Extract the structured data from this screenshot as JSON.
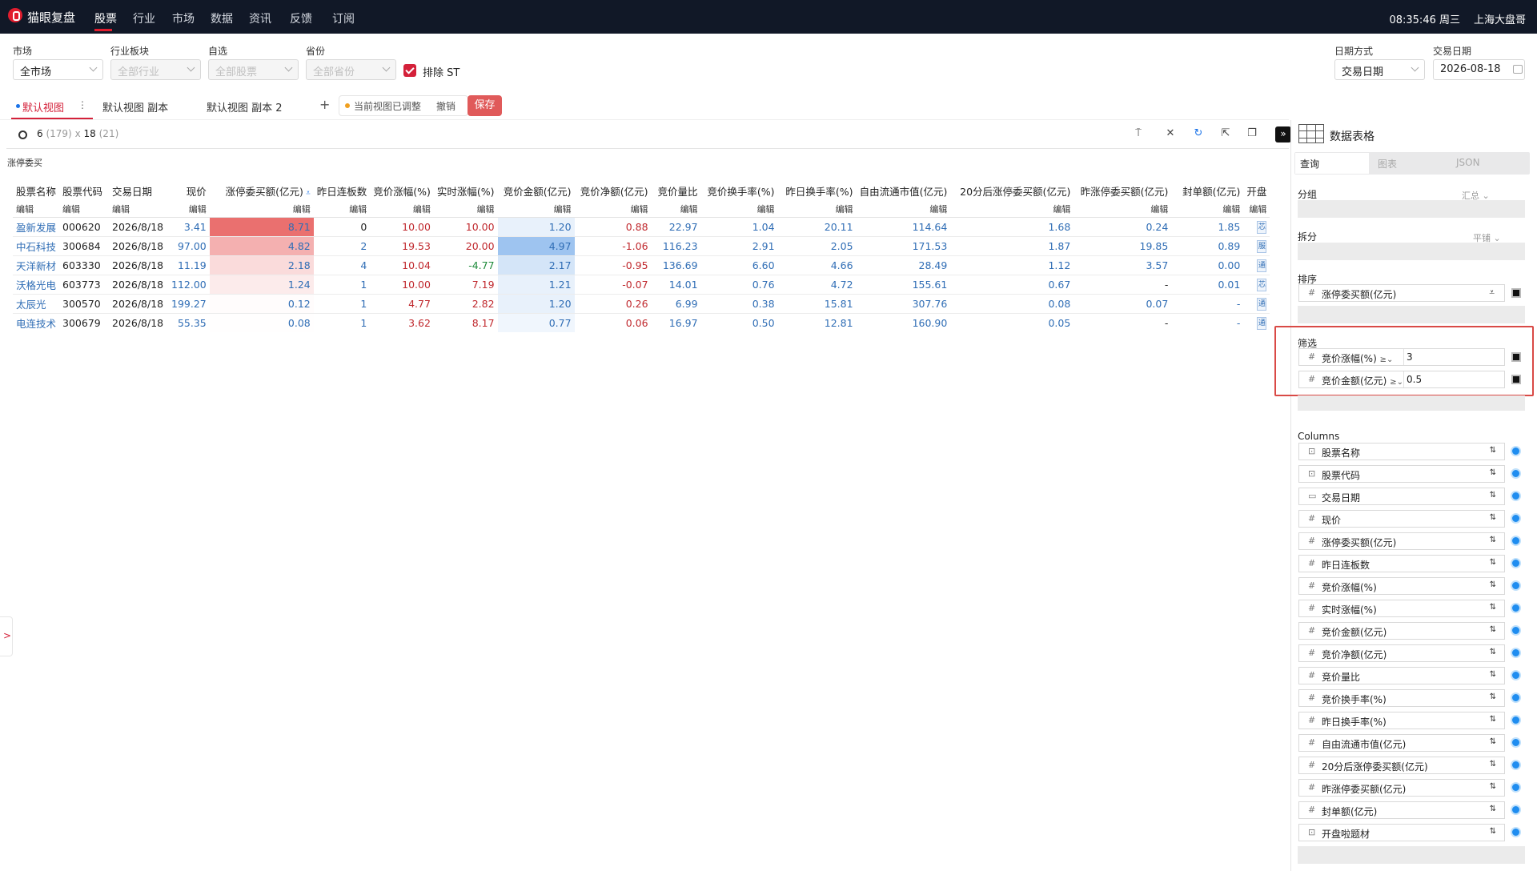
{
  "app": {
    "name": "猫眼复盘",
    "clock": "08:35:46 周三",
    "user": "上海大盘哥"
  },
  "nav": {
    "items": [
      "股票",
      "行业",
      "市场",
      "数据",
      "资讯",
      "反馈",
      "订阅"
    ],
    "active": "股票"
  },
  "filters": {
    "market": {
      "label": "市场",
      "value": "全市场"
    },
    "industry": {
      "label": "行业板块",
      "placeholder": "全部行业"
    },
    "watchlist": {
      "label": "自选",
      "placeholder": "全部股票"
    },
    "province": {
      "label": "省份",
      "placeholder": "全部省份"
    },
    "exclude_st": {
      "label": "排除 ST",
      "checked": true
    },
    "date_mode": {
      "label": "日期方式",
      "value": "交易日期"
    },
    "trade_date": {
      "label": "交易日期",
      "value": "2026-08-18"
    }
  },
  "views": {
    "tabs": [
      "默认视图",
      "默认视图 副本",
      "默认视图 副本 2"
    ],
    "add": "+",
    "adjusted_notice": "当前视图已调整",
    "undo": "撤销",
    "save": "保存"
  },
  "toolbar": {
    "rows": "6",
    "rows_total": "(179)",
    "times": "x",
    "cols": "18",
    "cols_total": "(21)",
    "caption": "涨停委买"
  },
  "table": {
    "columns": [
      "股票名称",
      "股票代码",
      "交易日期",
      "现价",
      "涨停委买额(亿元)",
      "昨日连板数",
      "竞价涨幅(%)",
      "实时涨幅(%)",
      "竞价金额(亿元)",
      "竞价净额(亿元)",
      "竞价量比",
      "竞价换手率(%)",
      "昨日换手率(%)",
      "自由流通市值(亿元)",
      "20分后涨停委买额(亿元)",
      "昨涨停委买额(亿元)",
      "封单额(亿元)",
      "开盘"
    ],
    "edit_label": "编辑",
    "rows": [
      [
        "盈新发展",
        "000620",
        "2026/8/18",
        "3.41",
        "8.71",
        "0",
        "10.00",
        "10.00",
        "1.20",
        "0.88",
        "22.97",
        "1.04",
        "20.11",
        "114.64",
        "1.68",
        "0.24",
        "1.85",
        "芯"
      ],
      [
        "中石科技",
        "300684",
        "2026/8/18",
        "97.00",
        "4.82",
        "2",
        "19.53",
        "20.00",
        "4.97",
        "-1.06",
        "116.23",
        "2.91",
        "2.05",
        "171.53",
        "1.87",
        "19.85",
        "0.89",
        "服"
      ],
      [
        "天洋新材",
        "603330",
        "2026/8/18",
        "11.19",
        "2.18",
        "4",
        "10.04",
        "-4.77",
        "2.17",
        "-0.95",
        "136.69",
        "6.60",
        "4.66",
        "28.49",
        "1.12",
        "3.57",
        "0.00",
        "通"
      ],
      [
        "沃格光电",
        "603773",
        "2026/8/18",
        "112.00",
        "1.24",
        "1",
        "10.00",
        "7.19",
        "1.21",
        "-0.07",
        "14.01",
        "0.76",
        "4.72",
        "155.61",
        "0.67",
        "-",
        "0.01",
        "芯"
      ],
      [
        "太辰光",
        "300570",
        "2026/8/18",
        "199.27",
        "0.12",
        "1",
        "4.77",
        "2.82",
        "1.20",
        "0.26",
        "6.99",
        "0.38",
        "15.81",
        "307.76",
        "0.08",
        "0.07",
        "-",
        "通"
      ],
      [
        "电连技术",
        "300679",
        "2026/8/18",
        "55.35",
        "0.08",
        "1",
        "3.62",
        "8.17",
        "0.77",
        "0.06",
        "16.97",
        "0.50",
        "12.81",
        "160.90",
        "0.05",
        "-",
        "-",
        "通"
      ]
    ],
    "heat": {
      "limit_up_bid": {
        "color": "#e8605f",
        "intensity": [
          1.0,
          0.55,
          0.25,
          0.14,
          0.02,
          0.01
        ]
      },
      "auction_amount": {
        "color": "#5d9de6",
        "intensity": [
          0.24,
          1.0,
          0.44,
          0.24,
          0.24,
          0.15
        ]
      }
    }
  },
  "panel": {
    "title": "数据表格",
    "tabs": [
      "查询",
      "图表",
      "JSON"
    ],
    "group": {
      "label": "分组",
      "hint": "汇总"
    },
    "split": {
      "label": "拆分",
      "hint": "平铺"
    },
    "sort": {
      "label": "排序",
      "items": [
        "涨停委买额(亿元)"
      ]
    },
    "filter": {
      "label": "筛选",
      "items": [
        {
          "field": "竞价涨幅(%)",
          "op": "≥",
          "value": "3"
        },
        {
          "field": "竞价金额(亿元)",
          "op": "≥",
          "value": "0.5"
        }
      ]
    },
    "columns_label": "Columns",
    "columns": [
      {
        "name": "股票名称",
        "type": "text"
      },
      {
        "name": "股票代码",
        "type": "text"
      },
      {
        "name": "交易日期",
        "type": "date"
      },
      {
        "name": "现价",
        "type": "num"
      },
      {
        "name": "涨停委买额(亿元)",
        "type": "num"
      },
      {
        "name": "昨日连板数",
        "type": "num"
      },
      {
        "name": "竞价涨幅(%)",
        "type": "num"
      },
      {
        "name": "实时涨幅(%)",
        "type": "num"
      },
      {
        "name": "竞价金额(亿元)",
        "type": "num"
      },
      {
        "name": "竞价净额(亿元)",
        "type": "num"
      },
      {
        "name": "竞价量比",
        "type": "num"
      },
      {
        "name": "竞价换手率(%)",
        "type": "num"
      },
      {
        "name": "昨日换手率(%)",
        "type": "num"
      },
      {
        "name": "自由流通市值(亿元)",
        "type": "num"
      },
      {
        "name": "20分后涨停委买额(亿元)",
        "type": "num"
      },
      {
        "name": "昨涨停委买额(亿元)",
        "type": "num"
      },
      {
        "name": "封单额(亿元)",
        "type": "num"
      },
      {
        "name": "开盘啦题材",
        "type": "text"
      }
    ]
  },
  "colors": {
    "accent": "#d4213a",
    "link": "#2f6db5",
    "nav_bg": "#111827",
    "positive": "#c0282d",
    "negative": "#1d8a3a"
  }
}
